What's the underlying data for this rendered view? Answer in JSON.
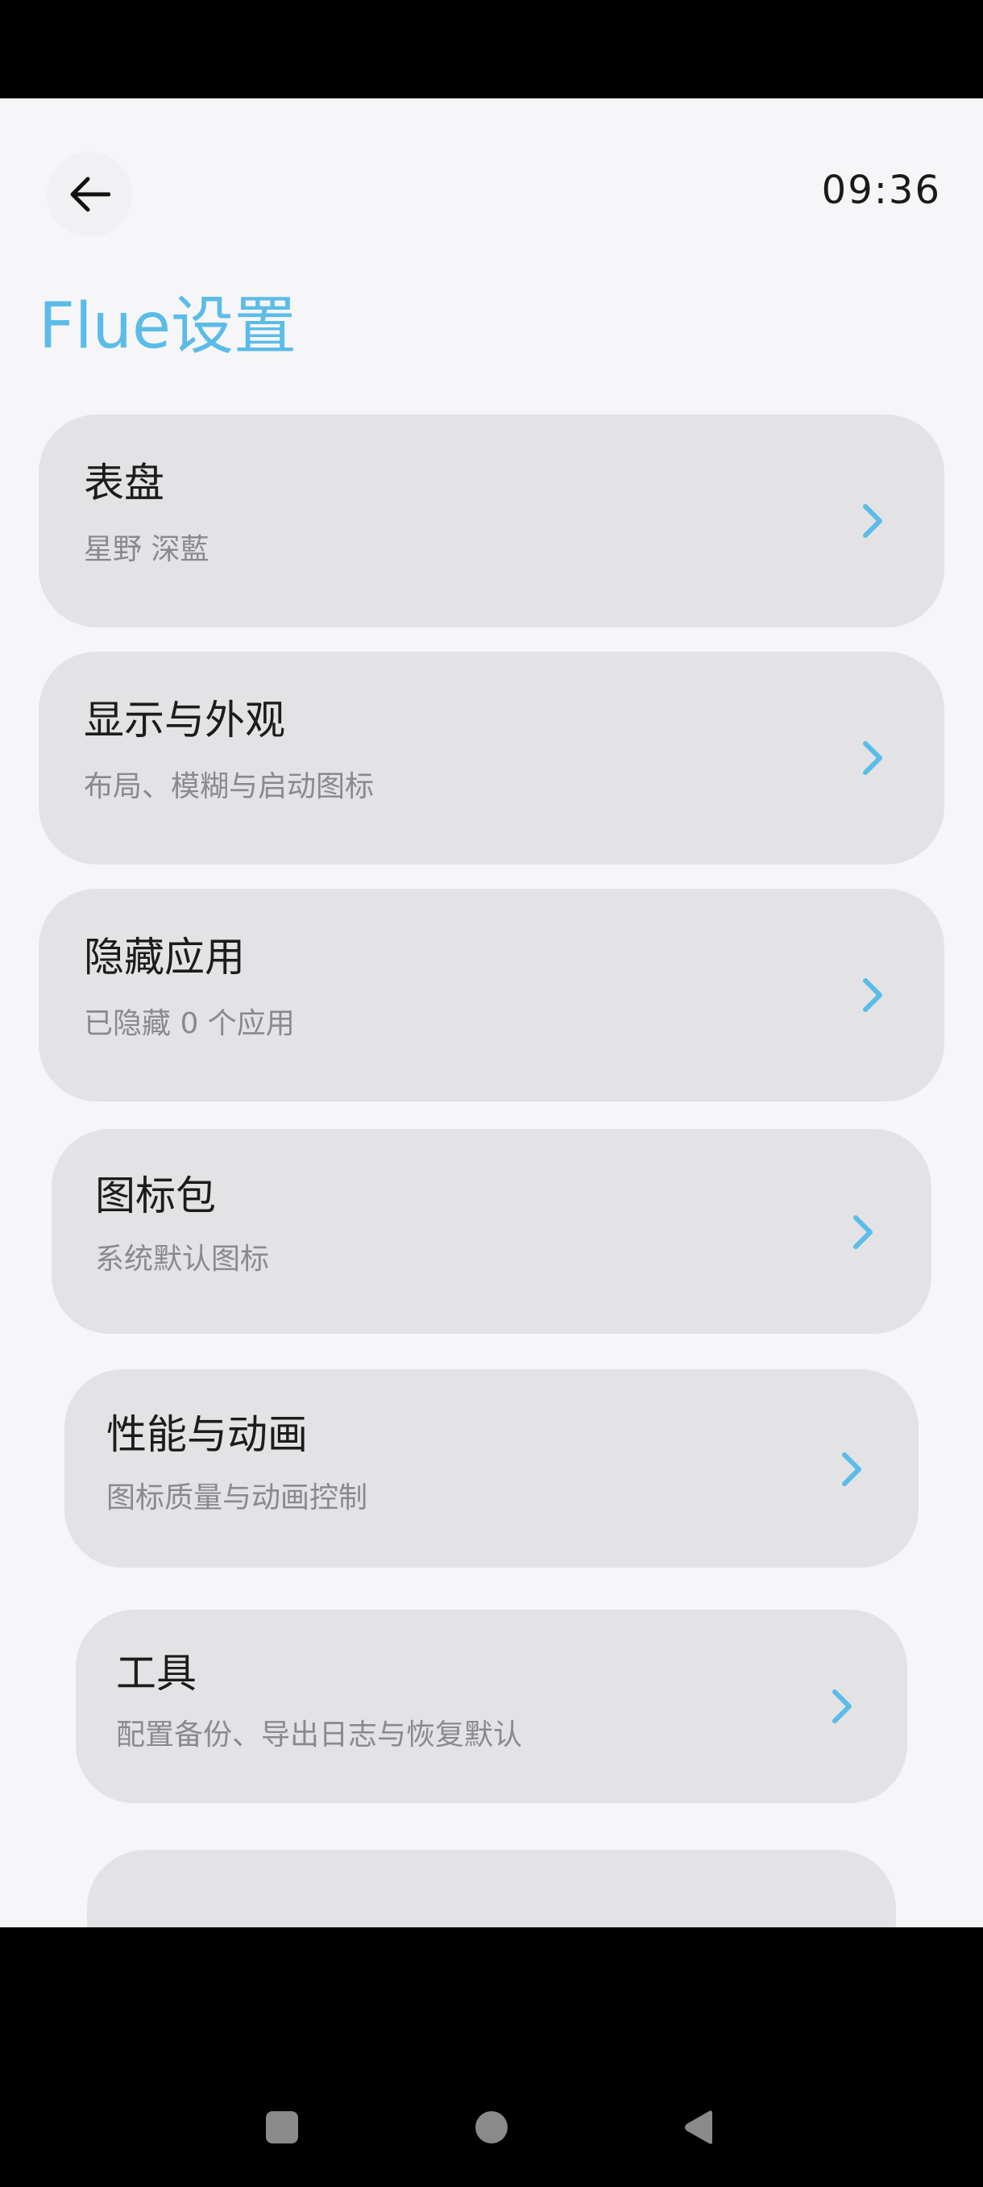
{
  "status": {
    "time": "09:36"
  },
  "page": {
    "title": "Flue设置"
  },
  "items": [
    {
      "label": "表盘",
      "sub": "星野 深藍"
    },
    {
      "label": "显示与外观",
      "sub": "布局、模糊与启动图标"
    },
    {
      "label": "隐藏应用",
      "sub": "已隐藏 0 个应用"
    },
    {
      "label": "图标包",
      "sub": "系统默认图标"
    },
    {
      "label": "性能与动画",
      "sub": "图标质量与动画控制"
    },
    {
      "label": "工具",
      "sub": "配置备份、导出日志与恢复默认"
    }
  ],
  "colors": {
    "accent": "#5bbce8",
    "background": "#f6f6f8",
    "card": "#e3e3e6"
  },
  "icons": {
    "back": "arrow-left-icon",
    "chevron": "chevron-right-icon",
    "nav_recents": "square-icon",
    "nav_home": "circle-icon",
    "nav_back": "triangle-left-icon"
  }
}
